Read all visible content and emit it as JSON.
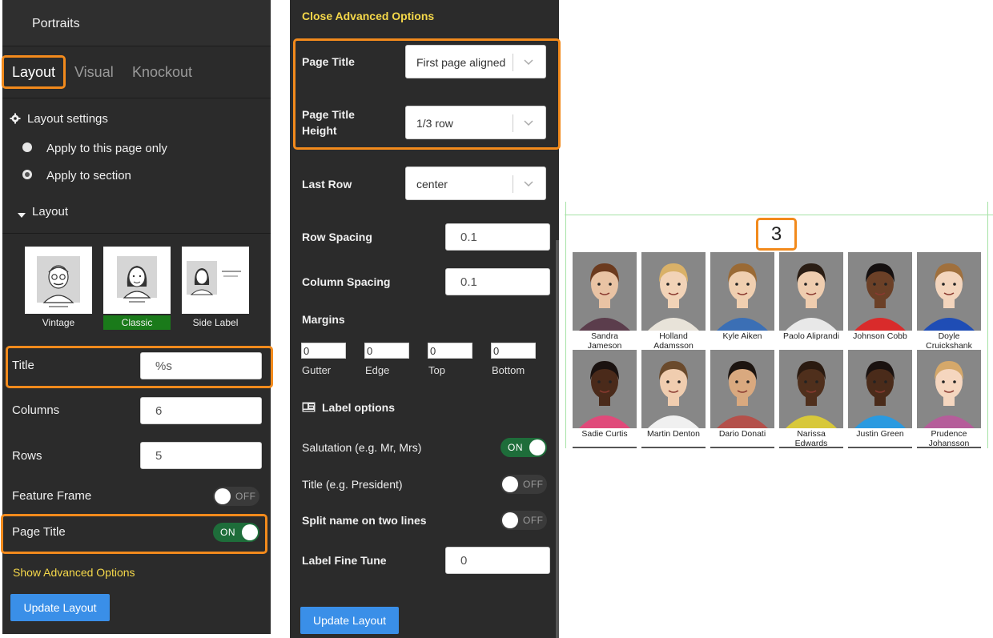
{
  "left_panel": {
    "header_title": "Portraits",
    "tabs": [
      {
        "label": "Layout",
        "active": true
      },
      {
        "label": "Visual",
        "active": false
      },
      {
        "label": "Knockout",
        "active": false
      }
    ],
    "layout_settings_label": "Layout settings",
    "scope_options": [
      {
        "label": "Apply to this page only",
        "selected": false
      },
      {
        "label": "Apply to section",
        "selected": true
      }
    ],
    "layout_section_label": "Layout",
    "thumbnails": [
      {
        "label": "Vintage",
        "selected": false
      },
      {
        "label": "Classic",
        "selected": true
      },
      {
        "label": "Side Label",
        "selected": false
      }
    ],
    "fields": {
      "title_label": "Title",
      "title_value": "%s",
      "columns_label": "Columns",
      "columns_value": "6",
      "rows_label": "Rows",
      "rows_value": "5"
    },
    "feature_frame": {
      "label": "Feature Frame",
      "state": "OFF"
    },
    "page_title": {
      "label": "Page Title",
      "state": "ON"
    },
    "advanced_link": "Show Advanced Options",
    "update_button": "Update Layout"
  },
  "middle_panel": {
    "advanced_link": "Close Advanced Options",
    "page_title": {
      "label": "Page Title",
      "value": "First page aligned"
    },
    "page_title_height": {
      "label_line1": "Page Title",
      "label_line2": "Height",
      "value": "1/3 row"
    },
    "last_row": {
      "label": "Last Row",
      "value": "center"
    },
    "row_spacing": {
      "label": "Row Spacing",
      "value": "0.1"
    },
    "column_spacing": {
      "label": "Column Spacing",
      "value": "0.1"
    },
    "margins_label": "Margins",
    "margins": [
      {
        "label": "Gutter",
        "value": "0"
      },
      {
        "label": "Edge",
        "value": "0"
      },
      {
        "label": "Top",
        "value": "0"
      },
      {
        "label": "Bottom",
        "value": "0"
      }
    ],
    "label_options_title": "Label options",
    "salutation": {
      "label": "Salutation (e.g. Mr, Mrs)",
      "state": "ON"
    },
    "title_toggle": {
      "label": "Title (e.g. President)",
      "state": "OFF"
    },
    "split_name": {
      "label": "Split name on two lines",
      "state": "OFF"
    },
    "label_fine_tune": {
      "label": "Label Fine Tune",
      "value": "0"
    },
    "update_button": "Update Layout"
  },
  "preview": {
    "page_number": "3",
    "row1": [
      {
        "name_line1": "Sandra",
        "name_line2": "Jameson"
      },
      {
        "name_line1": "Holland",
        "name_line2": "Adamsson"
      },
      {
        "name_line1": "Kyle Aiken",
        "name_line2": ""
      },
      {
        "name_line1": "Paolo Aliprandi",
        "name_line2": ""
      },
      {
        "name_line1": "Johnson Cobb",
        "name_line2": ""
      },
      {
        "name_line1": "Doyle",
        "name_line2": "Cruickshank"
      }
    ],
    "row2": [
      {
        "name_line1": "Sadie Curtis",
        "name_line2": ""
      },
      {
        "name_line1": "Martin Denton",
        "name_line2": ""
      },
      {
        "name_line1": "Dario Donati",
        "name_line2": ""
      },
      {
        "name_line1": "Narissa",
        "name_line2": "Edwards"
      },
      {
        "name_line1": "Justin Green",
        "name_line2": ""
      },
      {
        "name_line1": "Prudence",
        "name_line2": "Johansson"
      }
    ]
  },
  "colors": {
    "panel_bg": "#2b2b2b",
    "highlight": "#f28a1c",
    "toggle_on": "#1e6d3a",
    "link_yellow": "#f5d84a",
    "button_blue": "#3a8fe8",
    "classic_selected": "#1a7a1a",
    "guide_green": "#a6e2a6"
  }
}
